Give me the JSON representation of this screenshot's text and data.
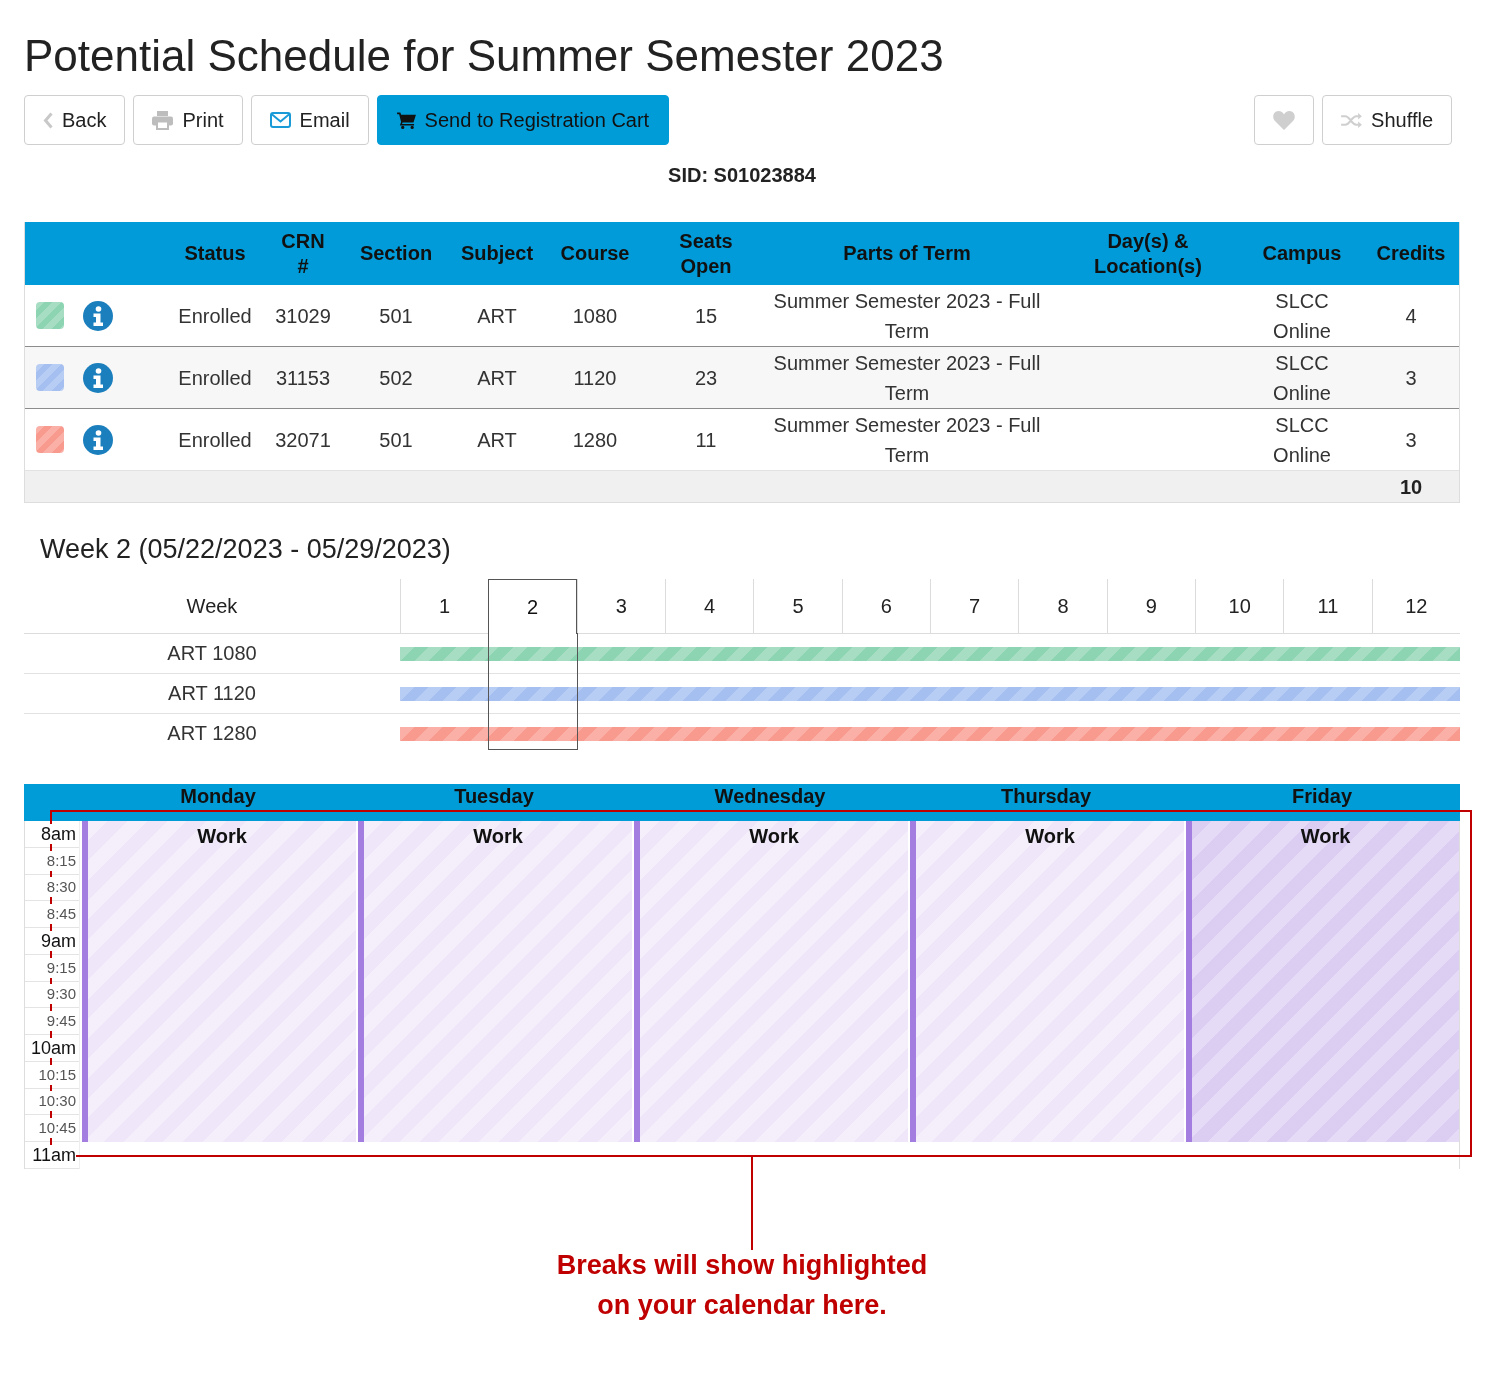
{
  "title": "Potential Schedule for Summer Semester 2023",
  "toolbar": {
    "left": [
      {
        "kind": "back",
        "label": "Back",
        "primary": false
      },
      {
        "kind": "print",
        "label": "Print",
        "primary": false
      },
      {
        "kind": "email",
        "label": "Email",
        "primary": false
      },
      {
        "kind": "cart",
        "label": "Send to Registration Cart",
        "primary": true
      }
    ],
    "right": [
      {
        "kind": "favorite",
        "primary": false
      },
      {
        "kind": "shuffle",
        "label": "Shuffle",
        "primary": false
      }
    ]
  },
  "sid": "SID: S01023884",
  "courses_table": {
    "columns": [
      "Status",
      "CRN #",
      "Section",
      "Subject",
      "Course",
      "Seats Open",
      "Parts of Term",
      "Day(s) & Location(s)",
      "Campus",
      "Credits"
    ],
    "rows": [
      {
        "color": "#8dd4b2",
        "status": "Enrolled",
        "crn": "31029",
        "section": "501",
        "subject": "ART",
        "course": "1080",
        "seats_open": "15",
        "parts_of_term": "Summer Semester 2023 - Full Term",
        "campus": "SLCC Online",
        "credits": "4"
      },
      {
        "color": "#a4bff0",
        "status": "Enrolled",
        "crn": "31153",
        "section": "502",
        "subject": "ART",
        "course": "1120",
        "seats_open": "23",
        "parts_of_term": "Summer Semester 2023 - Full Term",
        "campus": "SLCC Online",
        "credits": "3"
      },
      {
        "color": "#f99a8e",
        "status": "Enrolled",
        "crn": "32071",
        "section": "501",
        "subject": "ART",
        "course": "1280",
        "seats_open": "11",
        "parts_of_term": "Summer Semester 2023 - Full Term",
        "campus": "SLCC Online",
        "credits": "3"
      }
    ],
    "total_credits": "10"
  },
  "week_view": {
    "title": "Week 2 (05/22/2023 - 05/29/2023)",
    "label_heading": "Week",
    "weeks": [
      {
        "label": "1",
        "selected": false
      },
      {
        "label": "2",
        "selected": true
      },
      {
        "label": "3",
        "selected": false
      },
      {
        "label": "4",
        "selected": false
      },
      {
        "label": "5",
        "selected": false
      },
      {
        "label": "6",
        "selected": false
      },
      {
        "label": "7",
        "selected": false
      },
      {
        "label": "8",
        "selected": false
      },
      {
        "label": "9",
        "selected": false
      },
      {
        "label": "10",
        "selected": false
      },
      {
        "label": "11",
        "selected": false
      },
      {
        "label": "12",
        "selected": false
      }
    ],
    "courses": [
      {
        "label": "ART 1080",
        "color": "#8dd4b2"
      },
      {
        "label": "ART 1120",
        "color": "#a4bff0"
      },
      {
        "label": "ART 1280",
        "color": "#f99a8e"
      }
    ]
  },
  "calendar": {
    "days": [
      {
        "name": "Monday",
        "events": [
          {
            "title": "Work",
            "hovered": false
          }
        ]
      },
      {
        "name": "Tuesday",
        "events": [
          {
            "title": "Work",
            "hovered": false
          }
        ]
      },
      {
        "name": "Wednesday",
        "events": [
          {
            "title": "Work",
            "hovered": false
          }
        ]
      },
      {
        "name": "Thursday",
        "events": [
          {
            "title": "Work",
            "hovered": false
          }
        ]
      },
      {
        "name": "Friday",
        "events": [
          {
            "title": "Work",
            "hovered": true
          }
        ]
      }
    ],
    "times": [
      {
        "label": "8am",
        "kind": "hour"
      },
      {
        "label": "8:15",
        "kind": "quarter"
      },
      {
        "label": "8:30",
        "kind": "quarter"
      },
      {
        "label": "8:45",
        "kind": "quarter"
      },
      {
        "label": "9am",
        "kind": "hour"
      },
      {
        "label": "9:15",
        "kind": "quarter"
      },
      {
        "label": "9:30",
        "kind": "quarter"
      },
      {
        "label": "9:45",
        "kind": "quarter"
      },
      {
        "label": "10am",
        "kind": "hour"
      },
      {
        "label": "10:15",
        "kind": "quarter"
      },
      {
        "label": "10:30",
        "kind": "quarter"
      },
      {
        "label": "10:45",
        "kind": "quarter"
      },
      {
        "label": "11am",
        "kind": "hour"
      }
    ]
  },
  "callout": {
    "lines": [
      "Breaks will show highlighted",
      "on your calendar here."
    ]
  }
}
